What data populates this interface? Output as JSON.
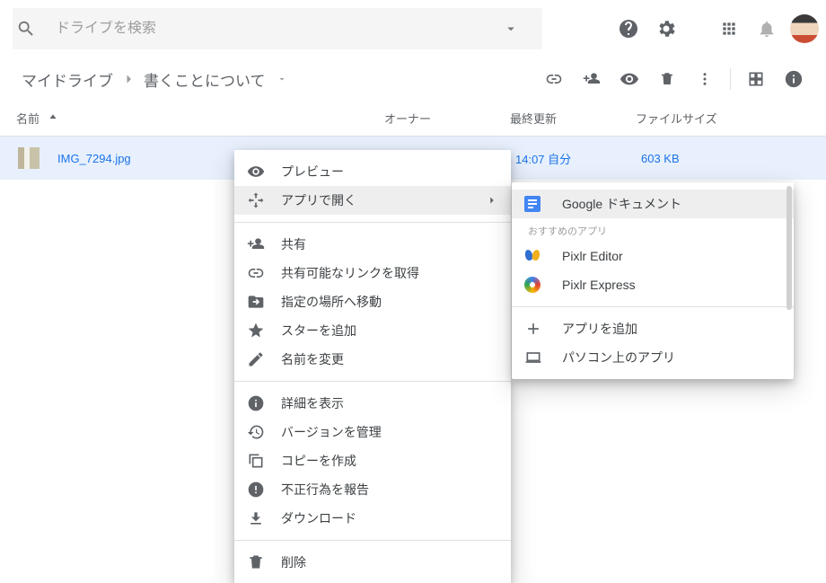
{
  "search": {
    "placeholder": "ドライブを検索"
  },
  "breadcrumb": {
    "root": "マイドライブ",
    "current": "書くことについて"
  },
  "columns": {
    "name": "名前",
    "owner": "オーナー",
    "modified": "最終更新",
    "size": "ファイルサイズ"
  },
  "file": {
    "name": "IMG_7294.jpg",
    "owner": "",
    "modified": "14:07 自分",
    "size": "603 KB"
  },
  "ctx": {
    "preview": "プレビュー",
    "open_with": "アプリで開く",
    "share": "共有",
    "get_link": "共有可能なリンクを取得",
    "move_to": "指定の場所へ移動",
    "add_star": "スターを追加",
    "rename": "名前を変更",
    "details": "詳細を表示",
    "versions": "バージョンを管理",
    "make_copy": "コピーを作成",
    "report": "不正行為を報告",
    "download": "ダウンロード",
    "remove": "削除"
  },
  "sub": {
    "gdoc": "Google ドキュメント",
    "recommended_label": "おすすめのアプリ",
    "pixlr_editor": "Pixlr Editor",
    "pixlr_express": "Pixlr Express",
    "add_app": "アプリを追加",
    "desktop_apps": "パソコン上のアプリ"
  }
}
